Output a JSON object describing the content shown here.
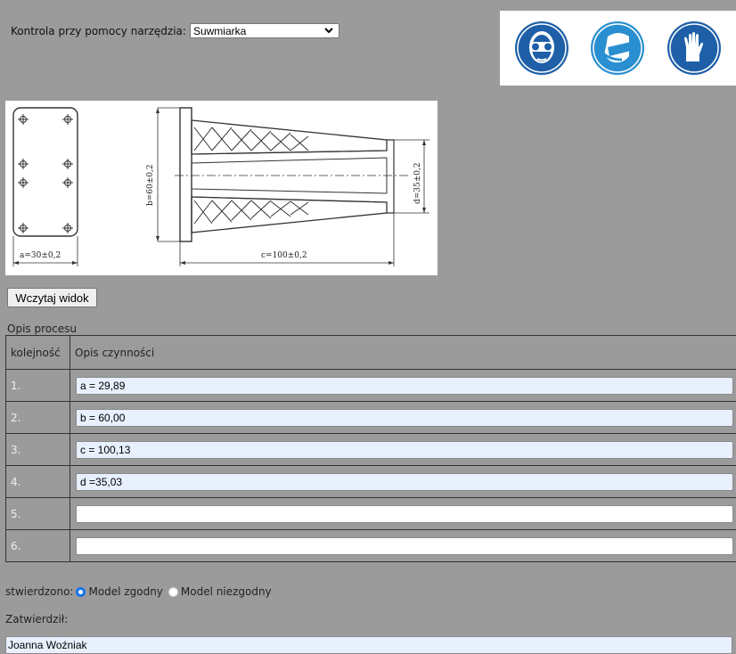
{
  "tool_select": {
    "label": "Kontrola przy pomocy narzędzia:",
    "value": "Suwmiarka"
  },
  "safety_icons": [
    "goggles-icon",
    "face-mask-icon",
    "gloves-icon"
  ],
  "drawing": {
    "dim_a": "a=30±0,2",
    "dim_b": "b=60±0,2",
    "dim_c": "c=100±0,2",
    "dim_d": "d=35±0,2"
  },
  "load_button": "Wczytaj widok",
  "process": {
    "caption": "Opis procesu",
    "col_order": "kolejność",
    "col_desc": "Opis czynności",
    "rows": [
      {
        "num": "1.",
        "value": "a = 29,89"
      },
      {
        "num": "2.",
        "value": "b = 60,00"
      },
      {
        "num": "3.",
        "value": "c = 100,13"
      },
      {
        "num": "4.",
        "value": "d =35,03"
      },
      {
        "num": "5.",
        "value": ""
      },
      {
        "num": "6.",
        "value": ""
      }
    ]
  },
  "verdict": {
    "label": "stwierdzono:",
    "option_ok": "Model zgodny",
    "option_bad": "Model niezgodny",
    "selected": "Model zgodny"
  },
  "approval": {
    "label": "Zatwierdził:",
    "value": "Joanna Woźniak"
  },
  "colors": {
    "background": "#9b9b9b",
    "autofill": "#e8f0fe",
    "safety_blue": "#1e5fa8"
  }
}
